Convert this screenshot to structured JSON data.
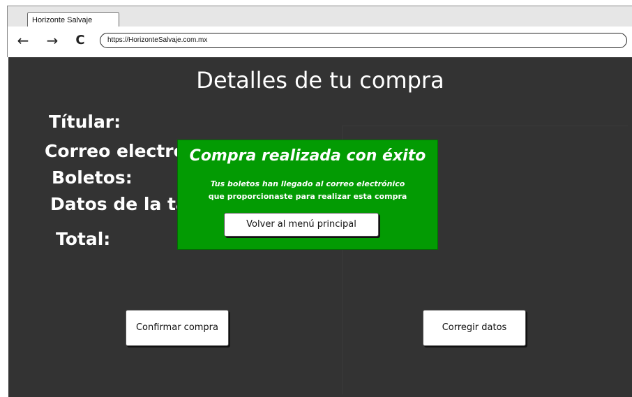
{
  "browser": {
    "tab_title": "Horizonte Salvaje",
    "url": "https://HorizonteSalvaje.com.mx",
    "back_icon": "←",
    "forward_icon": "→",
    "reload_icon": "C"
  },
  "page": {
    "title": "Detalles de tu compra",
    "fields": {
      "titular": "Títular:",
      "correo": "Correo electrónico:",
      "boletos": "Boletos:",
      "datos": "Datos de la tarjeta:",
      "total": "Total:"
    },
    "confirm_button": "Confirmar compra",
    "correct_button": "Corregir datos"
  },
  "modal": {
    "title": "Compra realizada con éxito",
    "message_line1": "Tus boletos han llegado al correo electrónico",
    "message_line2": "que proporcionaste para realizar esta compra",
    "menu_button": "Volver al menú principal",
    "background_color": "#039b03"
  },
  "colors": {
    "page_background": "#333333",
    "text": "#ffffff"
  }
}
